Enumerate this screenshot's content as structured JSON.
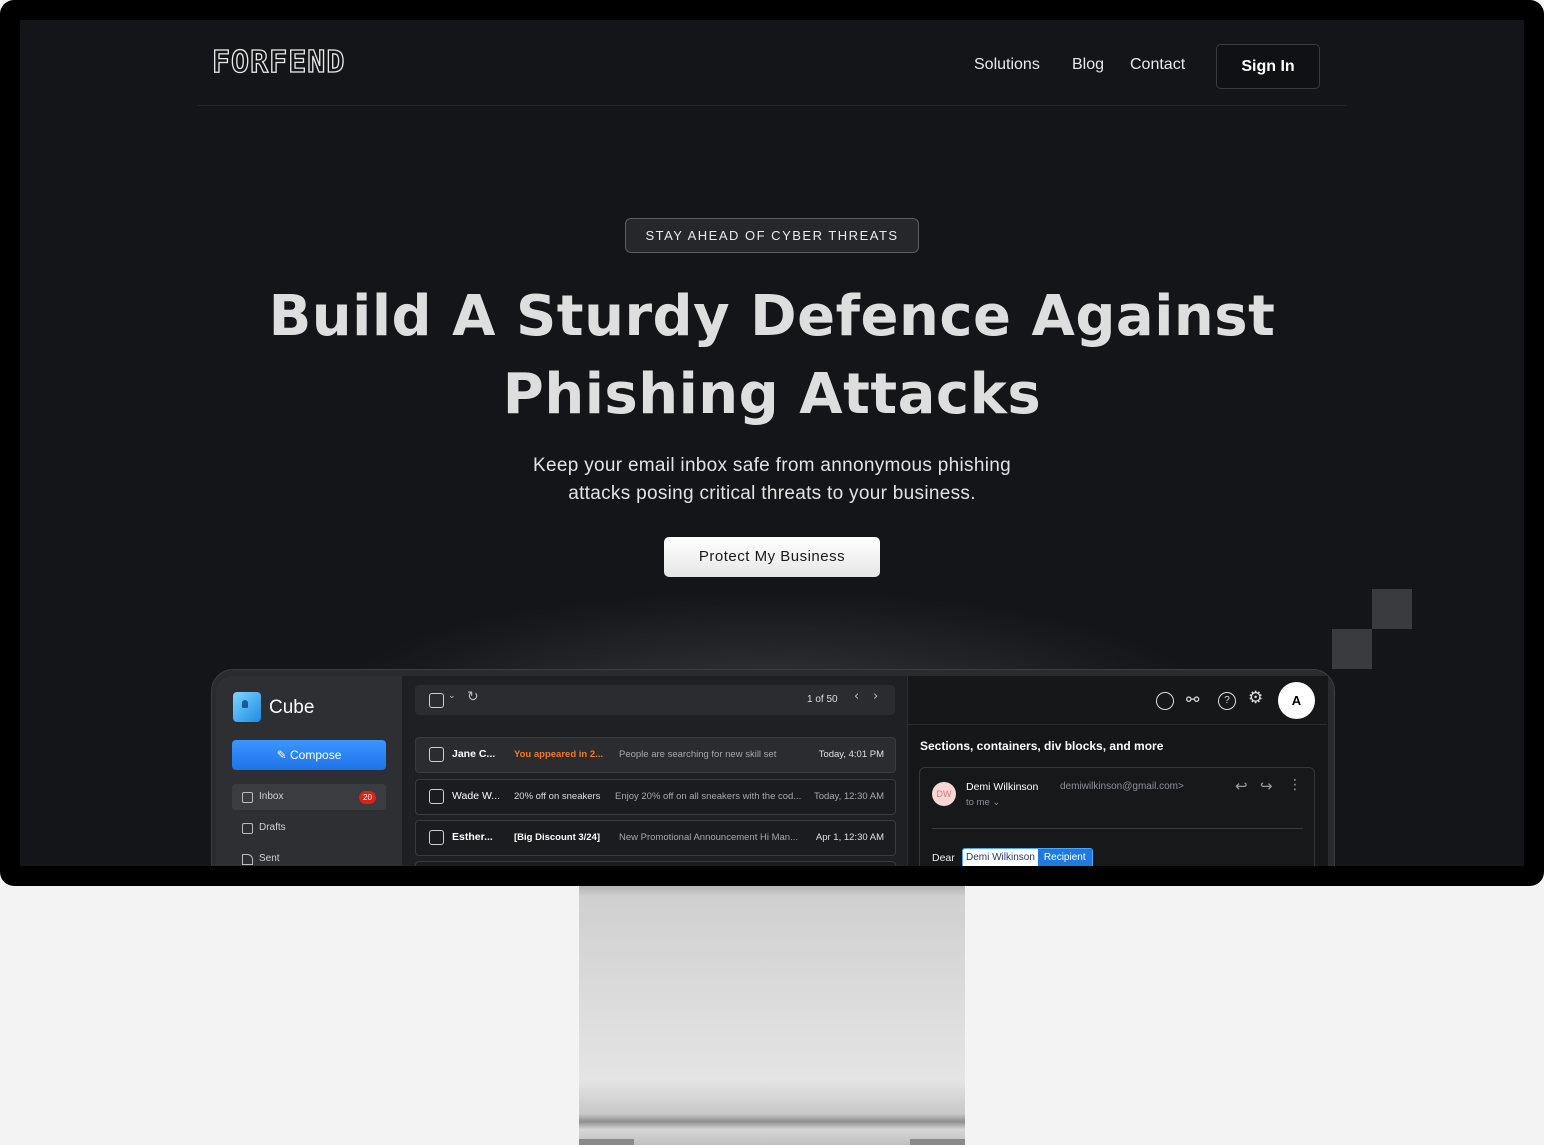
{
  "nav": {
    "logo": "FORFEND",
    "links": [
      "Solutions",
      "Blog",
      "Contact"
    ],
    "signin": "Sign In"
  },
  "hero": {
    "badge": "STAY AHEAD OF CYBER THREATS",
    "headline_line1": "Build A Sturdy Defence Against",
    "headline_line2": "Phishing Attacks",
    "sub_line1": "Keep your email inbox safe from annonymous phishing",
    "sub_line2": "attacks posing critical threats to your business.",
    "cta": "Protect My Business"
  },
  "app": {
    "name": "Cube",
    "compose": "Compose",
    "sidebar": [
      {
        "label": "Inbox",
        "count": "20",
        "icon": "inbox-icon"
      },
      {
        "label": "Drafts",
        "icon": "drafts-icon"
      },
      {
        "label": "Sent",
        "icon": "send-icon"
      }
    ],
    "pagination": "1 of 50",
    "emails": [
      {
        "sender": "Jane C...",
        "subject": "You appeared in 2...",
        "preview": "People are searching for new skill set",
        "time": "Today, 4:01 PM"
      },
      {
        "sender": "Wade W...",
        "subject": "20% off on sneakers",
        "preview": "Enjoy 20% off on all sneakers with the cod...",
        "time": "Today, 12:30 AM"
      },
      {
        "sender": "Esther...",
        "subject": "[Big Discount 3/24]",
        "preview": "New Promotional Announcement Hi Man...",
        "time": "Apr 1, 12:30 AM"
      }
    ],
    "avatar_initial": "A",
    "mail": {
      "subject": "Sections, containers, div blocks, and more",
      "from_initials": "DW",
      "from_name": "Demi Wilkinson",
      "from_email": "demiwilkinson@gmail.com>",
      "to": "to me",
      "greeting": "Dear",
      "chip_name": "Demi Wilkinson",
      "chip_tag": "Recipient"
    }
  },
  "colors": {
    "background": "#141518",
    "accent_blue": "#1f73e8",
    "badge_red": "#e01e1e",
    "subject_orange": "#f07a22"
  }
}
